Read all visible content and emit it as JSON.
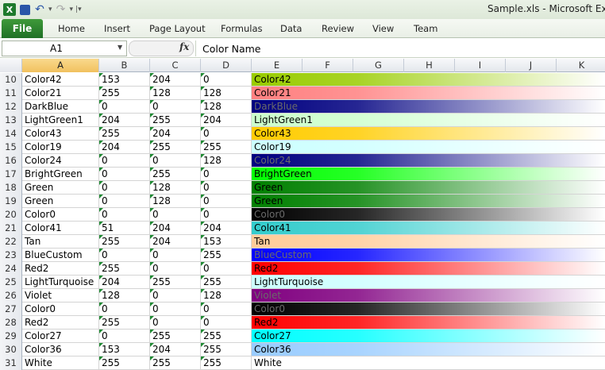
{
  "window": {
    "title": "Sample.xls  -  Microsoft Excel"
  },
  "ribbon": {
    "file_label": "File",
    "tabs": [
      "Home",
      "Insert",
      "Page Layout",
      "Formulas",
      "Data",
      "Review",
      "View",
      "Team"
    ]
  },
  "formula_bar": {
    "name_box": "A1",
    "fx_label": "fx",
    "content": "Color Name"
  },
  "columns": [
    "A",
    "B",
    "C",
    "D",
    "E",
    "F",
    "G",
    "H",
    "I",
    "J",
    "K"
  ],
  "rows": [
    {
      "n": "10",
      "name": "Color42",
      "r": "153",
      "g": "204",
      "b": "0",
      "color": "#99cc00"
    },
    {
      "n": "11",
      "name": "Color21",
      "r": "255",
      "g": "128",
      "b": "128",
      "color": "#ff8080"
    },
    {
      "n": "12",
      "name": "DarkBlue",
      "r": "0",
      "g": "0",
      "b": "128",
      "color": "#000080"
    },
    {
      "n": "13",
      "name": "LightGreen1",
      "r": "204",
      "g": "255",
      "b": "204",
      "color": "#ccffcc"
    },
    {
      "n": "14",
      "name": "Color43",
      "r": "255",
      "g": "204",
      "b": "0",
      "color": "#ffcc00"
    },
    {
      "n": "15",
      "name": "Color19",
      "r": "204",
      "g": "255",
      "b": "255",
      "color": "#ccffff"
    },
    {
      "n": "16",
      "name": "Color24",
      "r": "0",
      "g": "0",
      "b": "128",
      "color": "#000080"
    },
    {
      "n": "17",
      "name": "BrightGreen",
      "r": "0",
      "g": "255",
      "b": "0",
      "color": "#00ff00"
    },
    {
      "n": "18",
      "name": "Green",
      "r": "0",
      "g": "128",
      "b": "0",
      "color": "#008000"
    },
    {
      "n": "19",
      "name": "Green",
      "r": "0",
      "g": "128",
      "b": "0",
      "color": "#008000"
    },
    {
      "n": "20",
      "name": "Color0",
      "r": "0",
      "g": "0",
      "b": "0",
      "color": "#000000"
    },
    {
      "n": "21",
      "name": "Color41",
      "r": "51",
      "g": "204",
      "b": "204",
      "color": "#33cccc"
    },
    {
      "n": "22",
      "name": "Tan",
      "r": "255",
      "g": "204",
      "b": "153",
      "color": "#ffcc99"
    },
    {
      "n": "23",
      "name": "BlueCustom",
      "r": "0",
      "g": "0",
      "b": "255",
      "color": "#0000ff"
    },
    {
      "n": "24",
      "name": "Red2",
      "r": "255",
      "g": "0",
      "b": "0",
      "color": "#ff0000"
    },
    {
      "n": "25",
      "name": "LightTurquoise",
      "r": "204",
      "g": "255",
      "b": "255",
      "color": "#ccffff"
    },
    {
      "n": "26",
      "name": "Violet",
      "r": "128",
      "g": "0",
      "b": "128",
      "color": "#800080"
    },
    {
      "n": "27",
      "name": "Color0",
      "r": "0",
      "g": "0",
      "b": "0",
      "color": "#000000"
    },
    {
      "n": "28",
      "name": "Red2",
      "r": "255",
      "g": "0",
      "b": "0",
      "color": "#ff0000"
    },
    {
      "n": "29",
      "name": "Color27",
      "r": "0",
      "g": "255",
      "b": "255",
      "color": "#00ffff"
    },
    {
      "n": "30",
      "name": "Color36",
      "r": "153",
      "g": "204",
      "b": "255",
      "color": "#99ccff"
    },
    {
      "n": "31",
      "name": "White",
      "r": "255",
      "g": "255",
      "b": "255",
      "color": "#ffffff"
    }
  ]
}
